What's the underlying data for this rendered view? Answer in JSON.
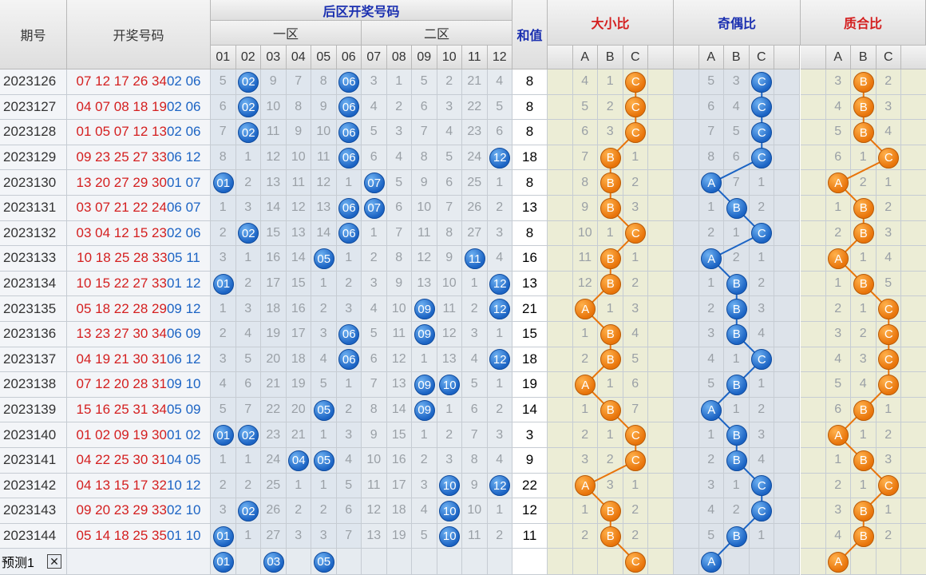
{
  "headers": {
    "period": "期号",
    "numbers": "开奖号码",
    "back_title": "后区开奖号码",
    "zone1": "一区",
    "zone2": "二区",
    "sum": "和值",
    "size_ratio": "大小比",
    "parity_ratio": "奇偶比",
    "prime_ratio": "质合比"
  },
  "back_cols": [
    "01",
    "02",
    "03",
    "04",
    "05",
    "06",
    "07",
    "08",
    "09",
    "10",
    "11",
    "12"
  ],
  "abc_cols": [
    "A",
    "B",
    "C"
  ],
  "colors": {
    "blue_ball": "#1c64c4",
    "orange_ball": "#e8740a",
    "red_text": "#d41f1f"
  },
  "predict": {
    "label": "预测1",
    "close_icon": "close-icon",
    "balls": [
      1,
      3,
      5
    ],
    "size": "C",
    "parity": "A",
    "prime": "A"
  },
  "chart_data": {
    "type": "table",
    "rows": [
      {
        "period": "2023126",
        "draw": "07 12 17 26 34 02 06",
        "back": [
          5,
          0,
          9,
          7,
          8,
          0,
          3,
          1,
          5,
          2,
          21,
          4
        ],
        "sum": 8,
        "size": [
          4,
          1,
          0
        ],
        "parity": [
          5,
          3,
          0
        ],
        "prime": [
          3,
          0,
          2
        ]
      },
      {
        "period": "2023127",
        "draw": "04 07 08 18 19 02 06",
        "back": [
          6,
          0,
          10,
          8,
          9,
          0,
          4,
          2,
          6,
          3,
          22,
          5
        ],
        "sum": 8,
        "size": [
          5,
          2,
          0
        ],
        "parity": [
          6,
          4,
          0
        ],
        "prime": [
          4,
          0,
          3
        ]
      },
      {
        "period": "2023128",
        "draw": "01 05 07 12 13 02 06",
        "back": [
          7,
          0,
          11,
          9,
          10,
          0,
          5,
          3,
          7,
          4,
          23,
          6
        ],
        "sum": 8,
        "size": [
          6,
          3,
          0
        ],
        "parity": [
          7,
          5,
          0
        ],
        "prime": [
          5,
          0,
          4
        ]
      },
      {
        "period": "2023129",
        "draw": "09 23 25 27 33 06 12",
        "back": [
          8,
          1,
          12,
          10,
          11,
          0,
          6,
          4,
          8,
          5,
          24,
          0
        ],
        "sum": 18,
        "size": [
          7,
          0,
          1
        ],
        "parity": [
          8,
          6,
          0
        ],
        "prime": [
          6,
          1,
          0
        ]
      },
      {
        "period": "2023130",
        "draw": "13 20 27 29 30 01 07",
        "back": [
          0,
          2,
          13,
          11,
          12,
          1,
          0,
          5,
          9,
          6,
          25,
          1
        ],
        "sum": 8,
        "size": [
          8,
          0,
          2
        ],
        "parity": [
          0,
          7,
          1
        ],
        "prime": [
          0,
          2,
          1
        ]
      },
      {
        "period": "2023131",
        "draw": "03 07 21 22 24 06 07",
        "back": [
          1,
          3,
          14,
          12,
          13,
          0,
          0,
          6,
          10,
          7,
          26,
          2
        ],
        "sum": 13,
        "size": [
          9,
          0,
          3
        ],
        "parity": [
          1,
          0,
          2
        ],
        "prime": [
          1,
          0,
          2
        ]
      },
      {
        "period": "2023132",
        "draw": "03 04 12 15 23 02 06",
        "back": [
          2,
          0,
          15,
          13,
          14,
          0,
          1,
          7,
          11,
          8,
          27,
          3
        ],
        "sum": 8,
        "size": [
          10,
          1,
          0
        ],
        "parity": [
          2,
          1,
          0
        ],
        "prime": [
          2,
          0,
          3
        ]
      },
      {
        "period": "2023133",
        "draw": "10 18 25 28 33 05 11",
        "back": [
          3,
          1,
          16,
          14,
          0,
          1,
          2,
          8,
          12,
          9,
          0,
          4
        ],
        "sum": 16,
        "size": [
          11,
          0,
          1
        ],
        "parity": [
          0,
          2,
          1
        ],
        "prime": [
          0,
          1,
          4
        ]
      },
      {
        "period": "2023134",
        "draw": "10 15 22 27 33 01 12",
        "back": [
          0,
          2,
          17,
          15,
          1,
          2,
          3,
          9,
          13,
          10,
          1,
          0
        ],
        "sum": 13,
        "size": [
          12,
          0,
          2
        ],
        "parity": [
          1,
          0,
          2
        ],
        "prime": [
          1,
          0,
          5
        ]
      },
      {
        "period": "2023135",
        "draw": "05 18 22 28 29 09 12",
        "back": [
          1,
          3,
          18,
          16,
          2,
          3,
          4,
          10,
          0,
          11,
          2,
          0
        ],
        "sum": 21,
        "size": [
          0,
          1,
          3
        ],
        "parity": [
          2,
          0,
          3
        ],
        "prime": [
          2,
          1,
          0
        ]
      },
      {
        "period": "2023136",
        "draw": "13 23 27 30 34 06 09",
        "back": [
          2,
          4,
          19,
          17,
          3,
          0,
          5,
          11,
          0,
          12,
          3,
          1
        ],
        "sum": 15,
        "size": [
          1,
          0,
          4
        ],
        "parity": [
          3,
          0,
          4
        ],
        "prime": [
          3,
          2,
          0
        ]
      },
      {
        "period": "2023137",
        "draw": "04 19 21 30 31 06 12",
        "back": [
          3,
          5,
          20,
          18,
          4,
          0,
          6,
          12,
          1,
          13,
          4,
          0
        ],
        "sum": 18,
        "size": [
          2,
          0,
          5
        ],
        "parity": [
          4,
          1,
          0
        ],
        "prime": [
          4,
          3,
          0
        ]
      },
      {
        "period": "2023138",
        "draw": "07 12 20 28 31 09 10",
        "back": [
          4,
          6,
          21,
          19,
          5,
          1,
          7,
          13,
          0,
          0,
          5,
          1
        ],
        "sum": 19,
        "size": [
          0,
          1,
          6
        ],
        "parity": [
          5,
          0,
          1
        ],
        "prime": [
          5,
          4,
          0
        ]
      },
      {
        "period": "2023139",
        "draw": "15 16 25 31 34 05 09",
        "back": [
          5,
          7,
          22,
          20,
          0,
          2,
          8,
          14,
          0,
          1,
          6,
          2
        ],
        "sum": 14,
        "size": [
          1,
          0,
          7
        ],
        "parity": [
          0,
          1,
          2
        ],
        "prime": [
          6,
          0,
          1
        ]
      },
      {
        "period": "2023140",
        "draw": "01 02 09 19 30 01 02",
        "back": [
          0,
          0,
          23,
          21,
          1,
          3,
          9,
          15,
          1,
          2,
          7,
          3
        ],
        "sum": 3,
        "size": [
          2,
          1,
          0
        ],
        "parity": [
          1,
          0,
          3
        ],
        "prime": [
          0,
          1,
          2
        ]
      },
      {
        "period": "2023141",
        "draw": "04 22 25 30 31 04 05",
        "back": [
          1,
          1,
          24,
          0,
          0,
          4,
          10,
          16,
          2,
          3,
          8,
          4
        ],
        "sum": 9,
        "size": [
          3,
          2,
          0
        ],
        "parity": [
          2,
          0,
          4
        ],
        "prime": [
          1,
          0,
          3
        ]
      },
      {
        "period": "2023142",
        "draw": "04 13 15 17 32 10 12",
        "back": [
          2,
          2,
          25,
          1,
          1,
          5,
          11,
          17,
          3,
          0,
          9,
          0
        ],
        "sum": 22,
        "size": [
          0,
          3,
          1
        ],
        "parity": [
          3,
          1,
          0
        ],
        "prime": [
          2,
          1,
          0
        ]
      },
      {
        "period": "2023143",
        "draw": "09 20 23 29 33 02 10",
        "back": [
          3,
          0,
          26,
          2,
          2,
          6,
          12,
          18,
          4,
          0,
          10,
          1
        ],
        "sum": 12,
        "size": [
          1,
          0,
          2
        ],
        "parity": [
          4,
          2,
          0
        ],
        "prime": [
          3,
          0,
          1
        ]
      },
      {
        "period": "2023144",
        "draw": "05 14 18 25 35 01 10",
        "back": [
          0,
          1,
          27,
          3,
          3,
          7,
          13,
          19,
          5,
          0,
          11,
          2
        ],
        "sum": 11,
        "size": [
          2,
          0,
          2
        ],
        "parity": [
          5,
          0,
          1
        ],
        "prime": [
          4,
          0,
          2
        ]
      }
    ]
  }
}
